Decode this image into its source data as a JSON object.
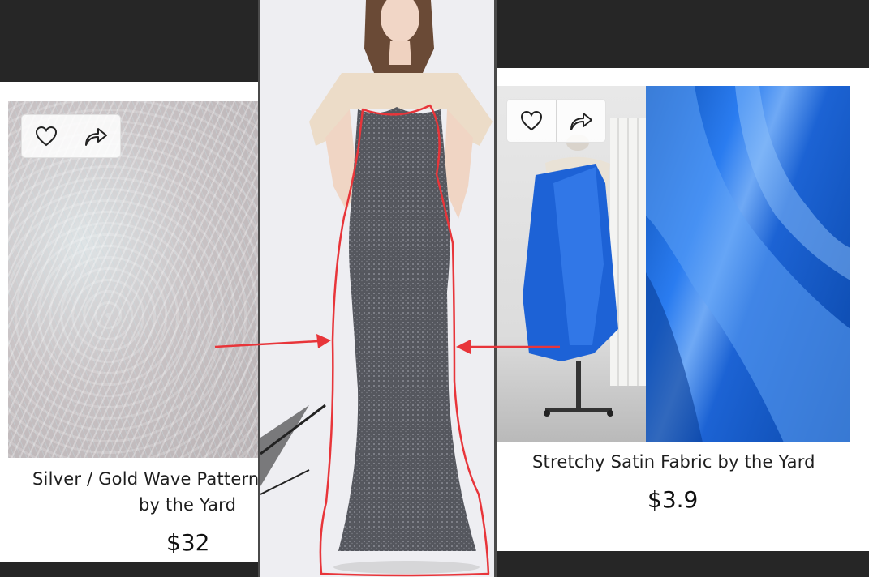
{
  "left_card": {
    "title_line_1": "Silver / Gold Wave Pattern",
    "title_line_2": "by the Yard",
    "price": "$32",
    "actions": [
      {
        "icon": "heart-icon"
      },
      {
        "icon": "share-icon"
      }
    ]
  },
  "right_card": {
    "title": "Stretchy Satin Fabric by the Yard",
    "price": "$3.9",
    "actions": [
      {
        "icon": "heart-icon"
      },
      {
        "icon": "share-icon"
      }
    ]
  },
  "colors": {
    "annotation_red": "#e8353a",
    "satin_blue": "#1c63d4",
    "gown_grey": "#5a5c63",
    "sleeve_beige": "#ead9c6"
  }
}
